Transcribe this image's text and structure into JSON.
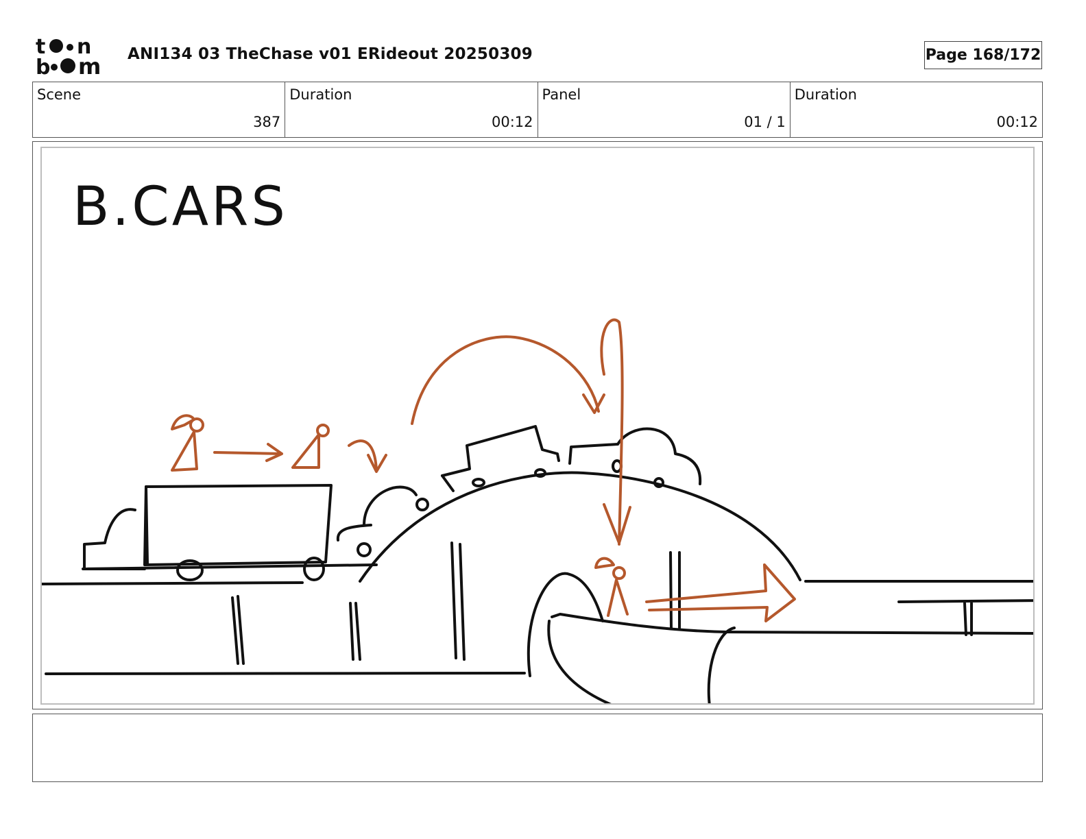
{
  "header": {
    "logo": {
      "line1": "toon",
      "line2": "boom",
      "icon": "toon-boom-logo"
    },
    "title": "ANI134 03 TheChase v01 ERideout 20250309",
    "page_label": "Page 168/172"
  },
  "info": {
    "scene_label": "Scene",
    "scene_value": "387",
    "duration_label": "Duration",
    "duration_value": "00:12",
    "panel_label": "Panel",
    "panel_value": "01 / 1",
    "panel_duration_label": "Duration",
    "panel_duration_value": "00:12"
  },
  "panel": {
    "sketch_caption": "B.CARS",
    "ink_color": "#111111",
    "action_color": "#b5582c"
  },
  "notes": {
    "text": ""
  }
}
